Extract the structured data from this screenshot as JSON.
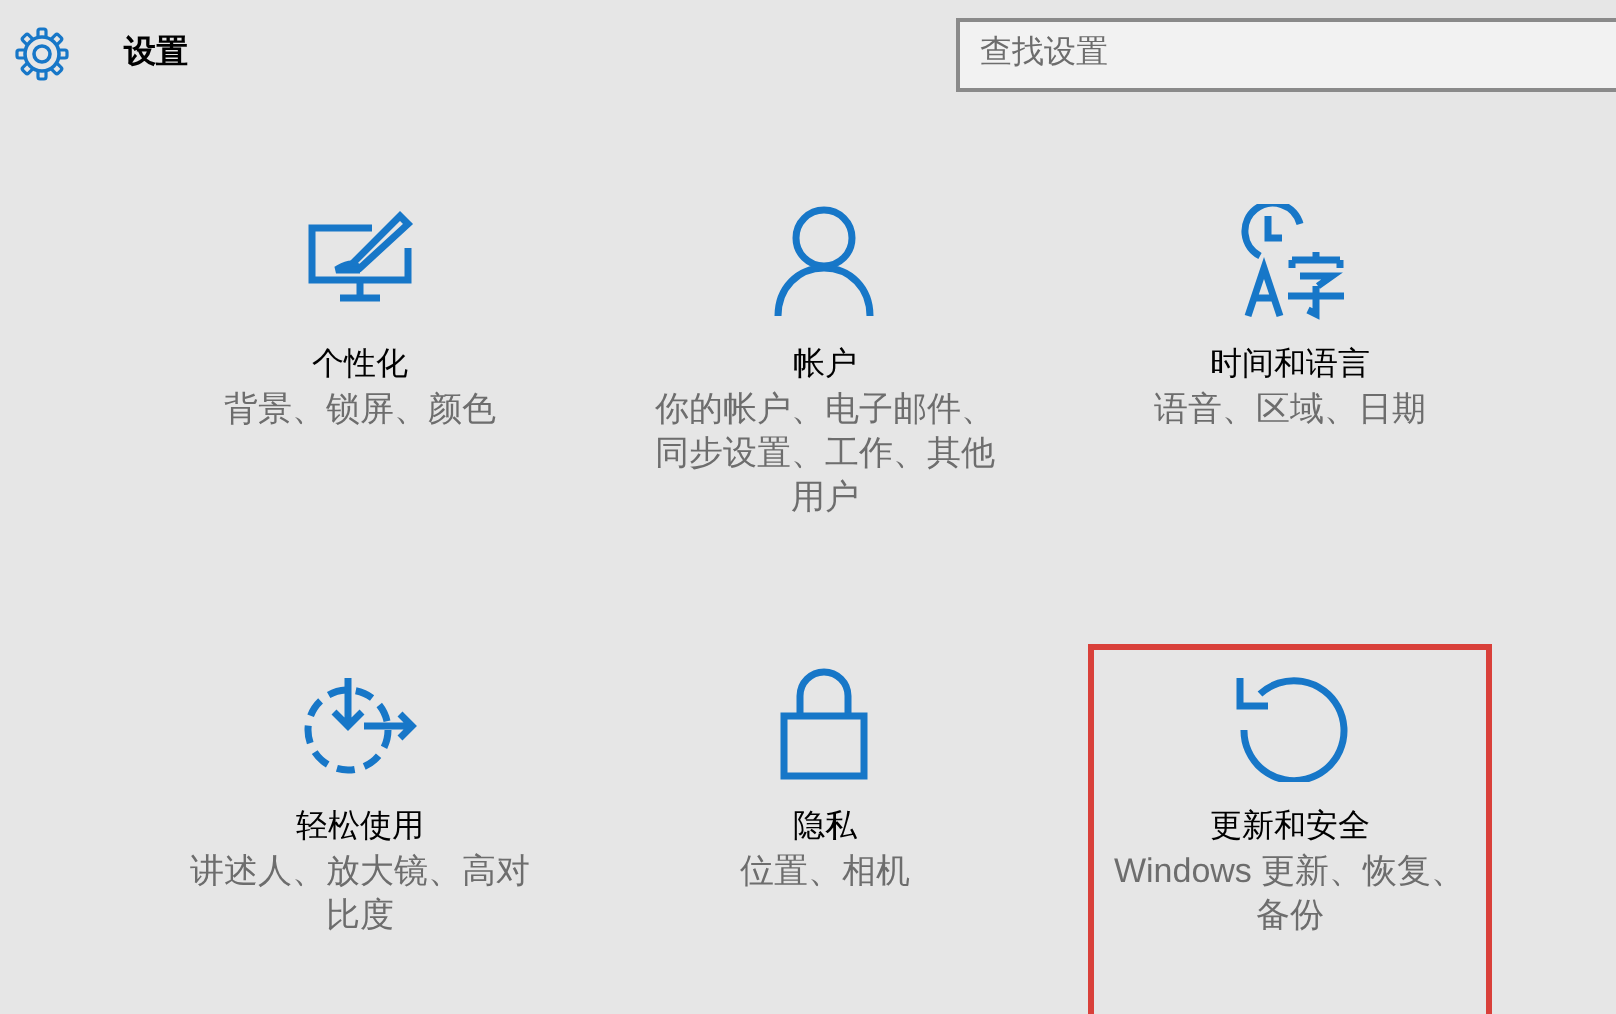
{
  "header": {
    "title": "设置"
  },
  "search": {
    "placeholder": "查找设置"
  },
  "tiles": [
    {
      "kind": "personalization",
      "title": "个性化",
      "description": "背景、锁屏、颜色",
      "highlighted": false
    },
    {
      "kind": "accounts",
      "title": "帐户",
      "description": "你的帐户、电子邮件、同步设置、工作、其他用户",
      "highlighted": false
    },
    {
      "kind": "time-language",
      "title": "时间和语言",
      "description": "语音、区域、日期",
      "highlighted": false
    },
    {
      "kind": "ease-of-access",
      "title": "轻松使用",
      "description": "讲述人、放大镜、高对比度",
      "highlighted": false
    },
    {
      "kind": "privacy",
      "title": "隐私",
      "description": "位置、相机",
      "highlighted": false
    },
    {
      "kind": "update-security",
      "title": "更新和安全",
      "description": "Windows 更新、恢复、备份",
      "highlighted": true
    }
  ]
}
